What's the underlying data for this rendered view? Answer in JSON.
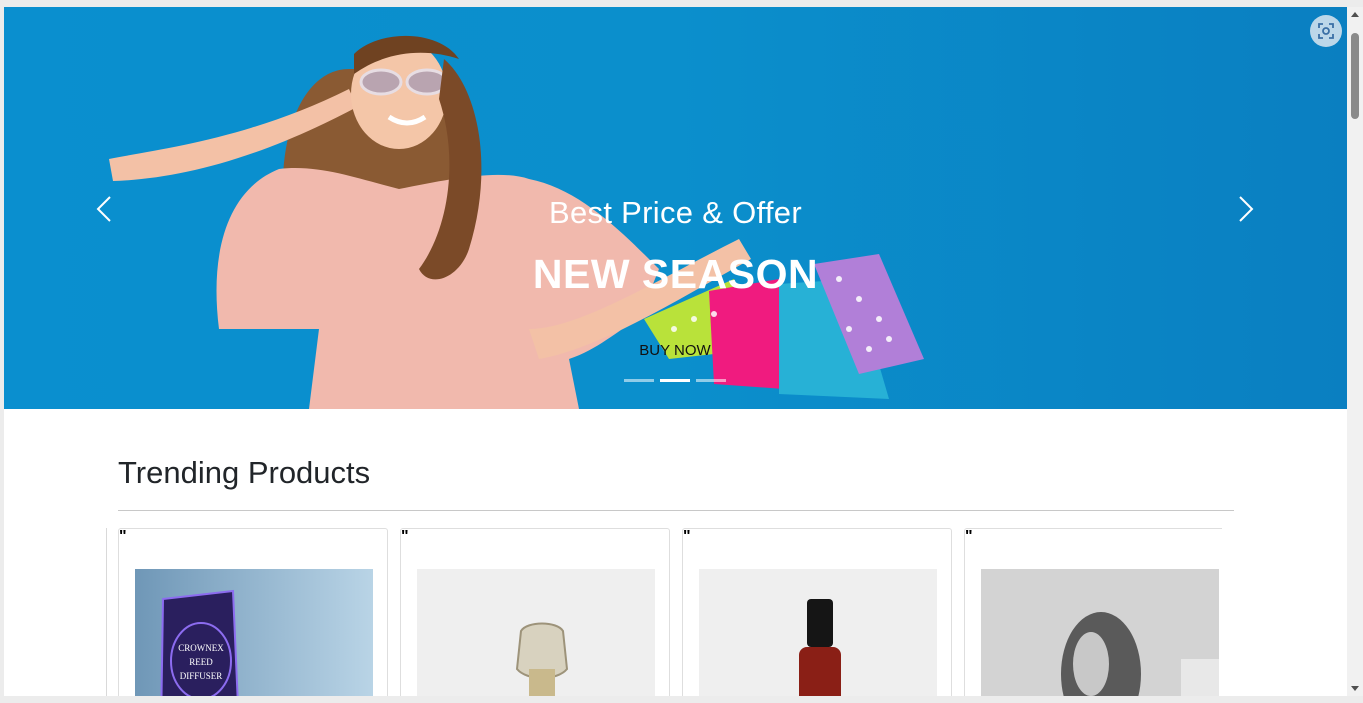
{
  "hero": {
    "subtitle": "Best Price & Offer",
    "title": "NEW SEASON",
    "cta_label": "BUY NOW",
    "slides": [
      {
        "active": false
      },
      {
        "active": true
      },
      {
        "active": false
      }
    ],
    "background_color": "#0a8fcf"
  },
  "trending": {
    "title": "Trending Products",
    "products": [
      {
        "mark": "\"",
        "image": "reed-diffuser-box",
        "image_text_lines": [
          "CROWNEX",
          "REED",
          "DIFFUSER"
        ]
      },
      {
        "mark": "\"",
        "image": "glass-perfume-bottle"
      },
      {
        "mark": "\"",
        "image": "red-perfume-bottle"
      },
      {
        "mark": "\"",
        "image": "chrome-egg-bottle"
      }
    ]
  },
  "icons": {
    "prev": "chevron-left-icon",
    "next": "chevron-right-icon",
    "scan": "screen-capture-icon"
  }
}
